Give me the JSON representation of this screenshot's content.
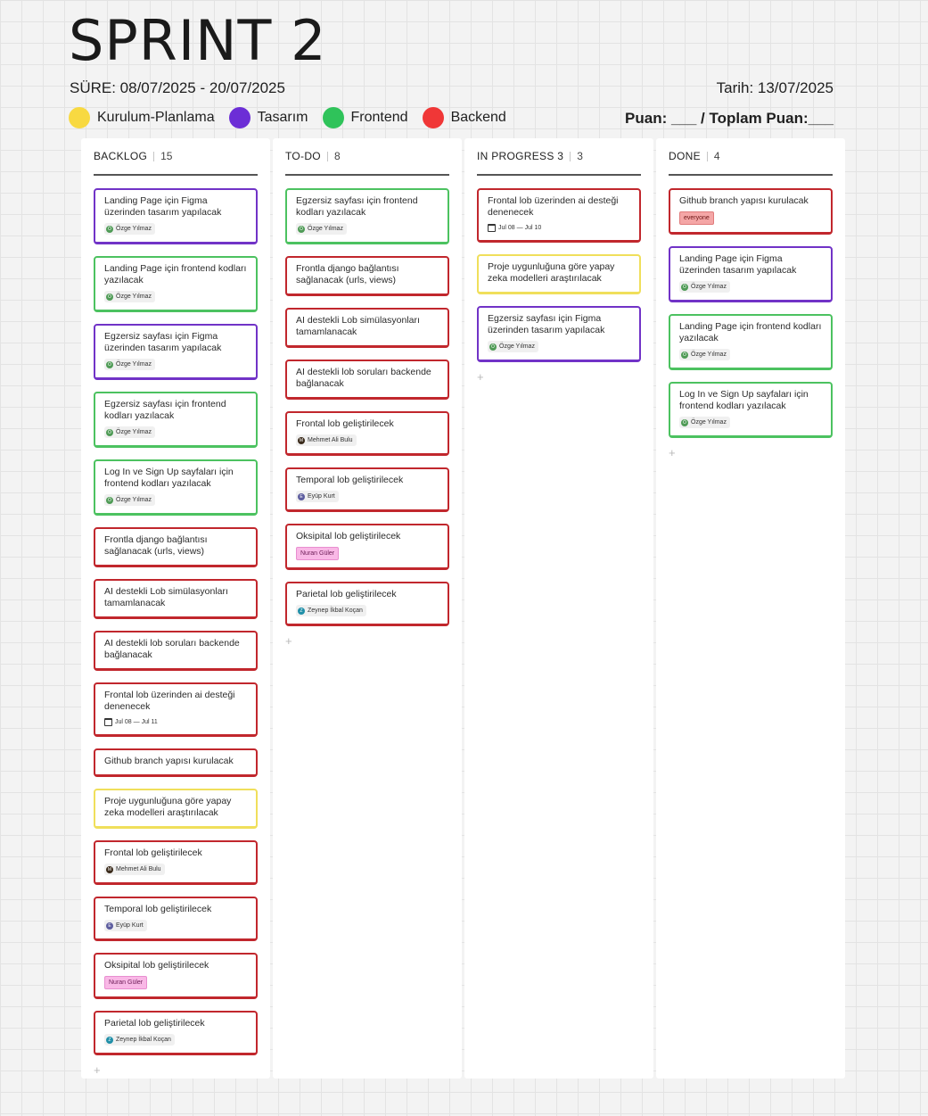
{
  "header": {
    "title": "SPRINT 2",
    "duration": "SÜRE: 08/07/2025 - 20/07/2025",
    "date": "Tarih: 13/07/2025",
    "score": "Puan: ___ / Toplam Puan:___"
  },
  "legend": [
    {
      "label": "Kurulum-Planlama",
      "color": "#f8d941"
    },
    {
      "label": "Tasarım",
      "color": "#6c2ed6"
    },
    {
      "label": "Frontend",
      "color": "#2fc35a"
    },
    {
      "label": "Backend",
      "color": "#f03737"
    }
  ],
  "colors": {
    "red": "#c1272d",
    "green": "#4cc260",
    "purple": "#7133c7",
    "yellow": "#f0df5b",
    "ozge_avatar": "#4f9b56",
    "mehmet_avatar": "#3a2a1a",
    "eyup_avatar": "#5c5c9e",
    "zeynep_avatar": "#1f8fa8"
  },
  "add_icon": "+",
  "columns": [
    {
      "name": "BACKLOG",
      "count": "15",
      "cards": [
        {
          "title": "Landing Page için Figma üzerinden tasarım yapılacak",
          "color": "purple",
          "assignee": "Özge Yılmaz",
          "avatar_color": "#4f9b56",
          "avatar_letter": "Ö"
        },
        {
          "title": "Landing Page için frontend kodları yazılacak",
          "color": "green",
          "assignee": "Özge Yılmaz",
          "avatar_color": "#4f9b56",
          "avatar_letter": "Ö"
        },
        {
          "title": "Egzersiz sayfası için Figma üzerinden tasarım yapılacak",
          "color": "purple",
          "assignee": "Özge Yılmaz",
          "avatar_color": "#4f9b56",
          "avatar_letter": "Ö"
        },
        {
          "title": "Egzersiz sayfası için frontend kodları yazılacak",
          "color": "green",
          "assignee": "Özge Yılmaz",
          "avatar_color": "#4f9b56",
          "avatar_letter": "Ö"
        },
        {
          "title": "Log In ve Sign Up sayfaları için frontend kodları yazılacak",
          "color": "green",
          "assignee": "Özge Yılmaz",
          "avatar_color": "#4f9b56",
          "avatar_letter": "Ö"
        },
        {
          "title": "Frontla django bağlantısı sağlanacak (urls, views)",
          "color": "red"
        },
        {
          "title": "AI destekli Lob simülasyonları tamamlanacak",
          "color": "red"
        },
        {
          "title": "AI destekli lob soruları backende bağlanacak",
          "color": "red"
        },
        {
          "title": "Frontal lob üzerinden ai desteği denenecek",
          "color": "red",
          "date": "Jul 08 — Jul 11"
        },
        {
          "title": "Github branch yapısı kurulacak",
          "color": "red"
        },
        {
          "title": "Proje uygunluğuna göre yapay zeka modelleri araştırılacak",
          "color": "yellow"
        },
        {
          "title": "Frontal lob geliştirilecek",
          "color": "red",
          "assignee": "Mehmet Ali Bulu",
          "avatar_color": "#3a2a1a",
          "avatar_letter": "M"
        },
        {
          "title": "Temporal lob geliştirilecek",
          "color": "red",
          "assignee": "Eyüp Kurt",
          "avatar_color": "#5c5c9e",
          "avatar_letter": "E"
        },
        {
          "title": "Oksipital lob geliştirilecek",
          "color": "red",
          "tag": "Nuran Güler",
          "tag_style": "pink"
        },
        {
          "title": "Parietal lob geliştirilecek",
          "color": "red",
          "assignee": "Zeynep İkbal Koçan",
          "avatar_color": "#1f8fa8",
          "avatar_letter": "Z"
        }
      ]
    },
    {
      "name": "TO-DO",
      "count": "8",
      "cards": [
        {
          "title": "Egzersiz sayfası için frontend kodları yazılacak",
          "color": "green",
          "assignee": "Özge Yılmaz",
          "avatar_color": "#4f9b56",
          "avatar_letter": "Ö"
        },
        {
          "title": "Frontla django bağlantısı sağlanacak (urls, views)",
          "color": "red"
        },
        {
          "title": "AI destekli Lob simülasyonları tamamlanacak",
          "color": "red"
        },
        {
          "title": "AI destekli lob soruları backende bağlanacak",
          "color": "red"
        },
        {
          "title": "Frontal lob geliştirilecek",
          "color": "red",
          "assignee": "Mehmet Ali Bulu",
          "avatar_color": "#3a2a1a",
          "avatar_letter": "M"
        },
        {
          "title": "Temporal lob geliştirilecek",
          "color": "red",
          "assignee": "Eyüp Kurt",
          "avatar_color": "#5c5c9e",
          "avatar_letter": "E"
        },
        {
          "title": "Oksipital lob geliştirilecek",
          "color": "red",
          "tag": "Nuran Güler",
          "tag_style": "pink"
        },
        {
          "title": "Parietal lob geliştirilecek",
          "color": "red",
          "assignee": "Zeynep İkbal Koçan",
          "avatar_color": "#1f8fa8",
          "avatar_letter": "Z"
        }
      ]
    },
    {
      "name": "IN PROGRESS 3",
      "count": "3",
      "cards": [
        {
          "title": "Frontal lob üzerinden ai desteği denenecek",
          "color": "red",
          "date": "Jul 08 — Jul 10"
        },
        {
          "title": "Proje uygunluğuna göre yapay zeka modelleri araştırılacak",
          "color": "yellow"
        },
        {
          "title": "Egzersiz sayfası için Figma üzerinden tasarım yapılacak",
          "color": "purple",
          "assignee": "Özge Yılmaz",
          "avatar_color": "#4f9b56",
          "avatar_letter": "Ö"
        }
      ]
    },
    {
      "name": "DONE",
      "count": "4",
      "cards": [
        {
          "title": "Github branch yapısı kurulacak",
          "color": "red",
          "tag": "everyone",
          "tag_style": "salmon"
        },
        {
          "title": "Landing Page için Figma üzerinden tasarım yapılacak",
          "color": "purple",
          "assignee": "Özge Yılmaz",
          "avatar_color": "#4f9b56",
          "avatar_letter": "Ö"
        },
        {
          "title": "Landing Page için frontend kodları yazılacak",
          "color": "green",
          "assignee": "Özge Yılmaz",
          "avatar_color": "#4f9b56",
          "avatar_letter": "Ö"
        },
        {
          "title": "Log In ve Sign Up sayfaları için frontend kodları yazılacak",
          "color": "green",
          "assignee": "Özge Yılmaz",
          "avatar_color": "#4f9b56",
          "avatar_letter": "Ö"
        }
      ]
    }
  ]
}
